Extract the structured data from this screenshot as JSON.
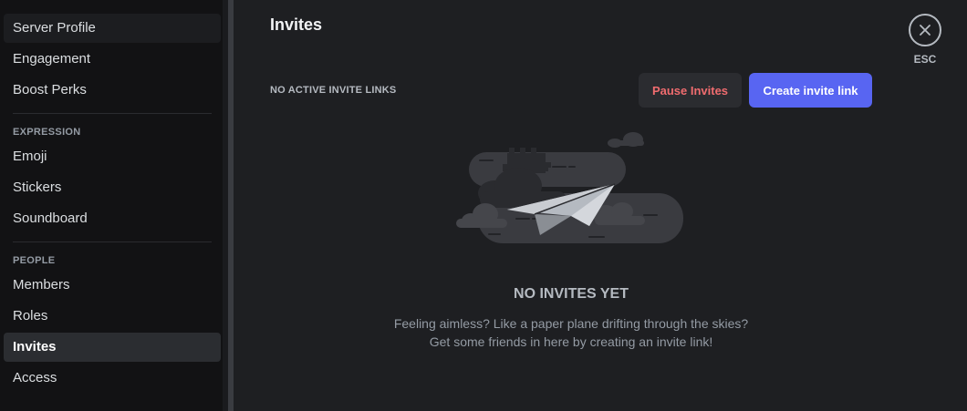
{
  "sidebar": {
    "items_top": [
      {
        "label": "Server Profile"
      },
      {
        "label": "Engagement"
      },
      {
        "label": "Boost Perks"
      }
    ],
    "expression_header": "EXPRESSION",
    "expression_items": [
      {
        "label": "Emoji"
      },
      {
        "label": "Stickers"
      },
      {
        "label": "Soundboard"
      }
    ],
    "people_header": "PEOPLE",
    "people_items": [
      {
        "label": "Members"
      },
      {
        "label": "Roles"
      },
      {
        "label": "Invites",
        "selected": true
      },
      {
        "label": "Access"
      }
    ]
  },
  "main": {
    "title": "Invites",
    "section_label": "NO ACTIVE INVITE LINKS",
    "pause_button": "Pause Invites",
    "create_button": "Create invite link",
    "close": {
      "icon": "close-icon",
      "label": "ESC"
    },
    "empty_state": {
      "illustration": "paper-plane-icon",
      "title": "NO INVITES YET",
      "line1": "Feeling aimless? Like a paper plane drifting through the skies?",
      "line2": "Get some friends in here by creating an invite link!"
    }
  },
  "colors": {
    "accent": "#5865f2",
    "danger_text": "#f06c6f",
    "selected_bg": "#2b2d31"
  }
}
